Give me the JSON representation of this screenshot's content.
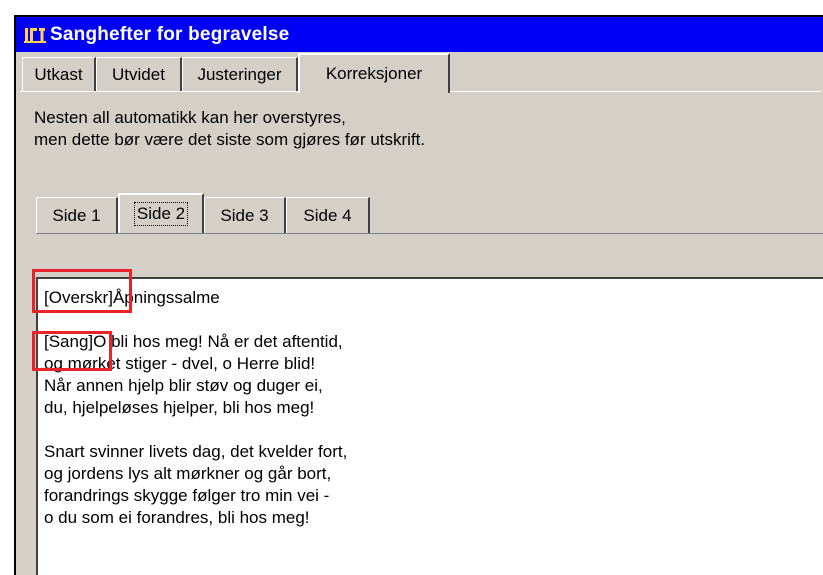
{
  "window": {
    "title": "Sanghefter for begravelse",
    "icon": "app-logo-icon"
  },
  "outer_tabs": [
    {
      "label": "Utkast",
      "active": false
    },
    {
      "label": "Utvidet",
      "active": false
    },
    {
      "label": "Justeringer",
      "active": false
    },
    {
      "label": "Korreksjoner",
      "active": true
    }
  ],
  "description": {
    "line1": "Nesten all automatikk kan her overstyres,",
    "line2": "men dette bør være det siste som gjøres før utskrift."
  },
  "page_tabs": [
    {
      "label": "Side 1",
      "active": false
    },
    {
      "label": "Side 2",
      "active": true
    },
    {
      "label": "Side 3",
      "active": false
    },
    {
      "label": "Side 4",
      "active": false
    }
  ],
  "editor": {
    "lines": [
      {
        "tag": "[Overskr]",
        "text": "Åpningssalme"
      },
      {
        "tag": "",
        "text": ""
      },
      {
        "tag": "[Sang]",
        "text": "O bli hos meg! Nå er det aftentid,"
      },
      {
        "tag": "",
        "text": "og mørket stiger - dvel, o Herre blid!"
      },
      {
        "tag": "",
        "text": "Når annen hjelp blir støv og duger ei,"
      },
      {
        "tag": "",
        "text": "du, hjelpeløses hjelper, bli hos meg!"
      },
      {
        "tag": "",
        "text": ""
      },
      {
        "tag": "",
        "text": "Snart svinner livets dag, det kvelder fort,"
      },
      {
        "tag": "",
        "text": "og jordens lys alt mørkner og går bort,"
      },
      {
        "tag": "",
        "text": "forandrings skygge følger tro min vei -"
      },
      {
        "tag": "",
        "text": "o du som ei forandres, bli hos meg!"
      }
    ]
  },
  "colors": {
    "titlebar": "#0000f5",
    "highlight": "#e8242a",
    "face": "#d4d0c8"
  }
}
